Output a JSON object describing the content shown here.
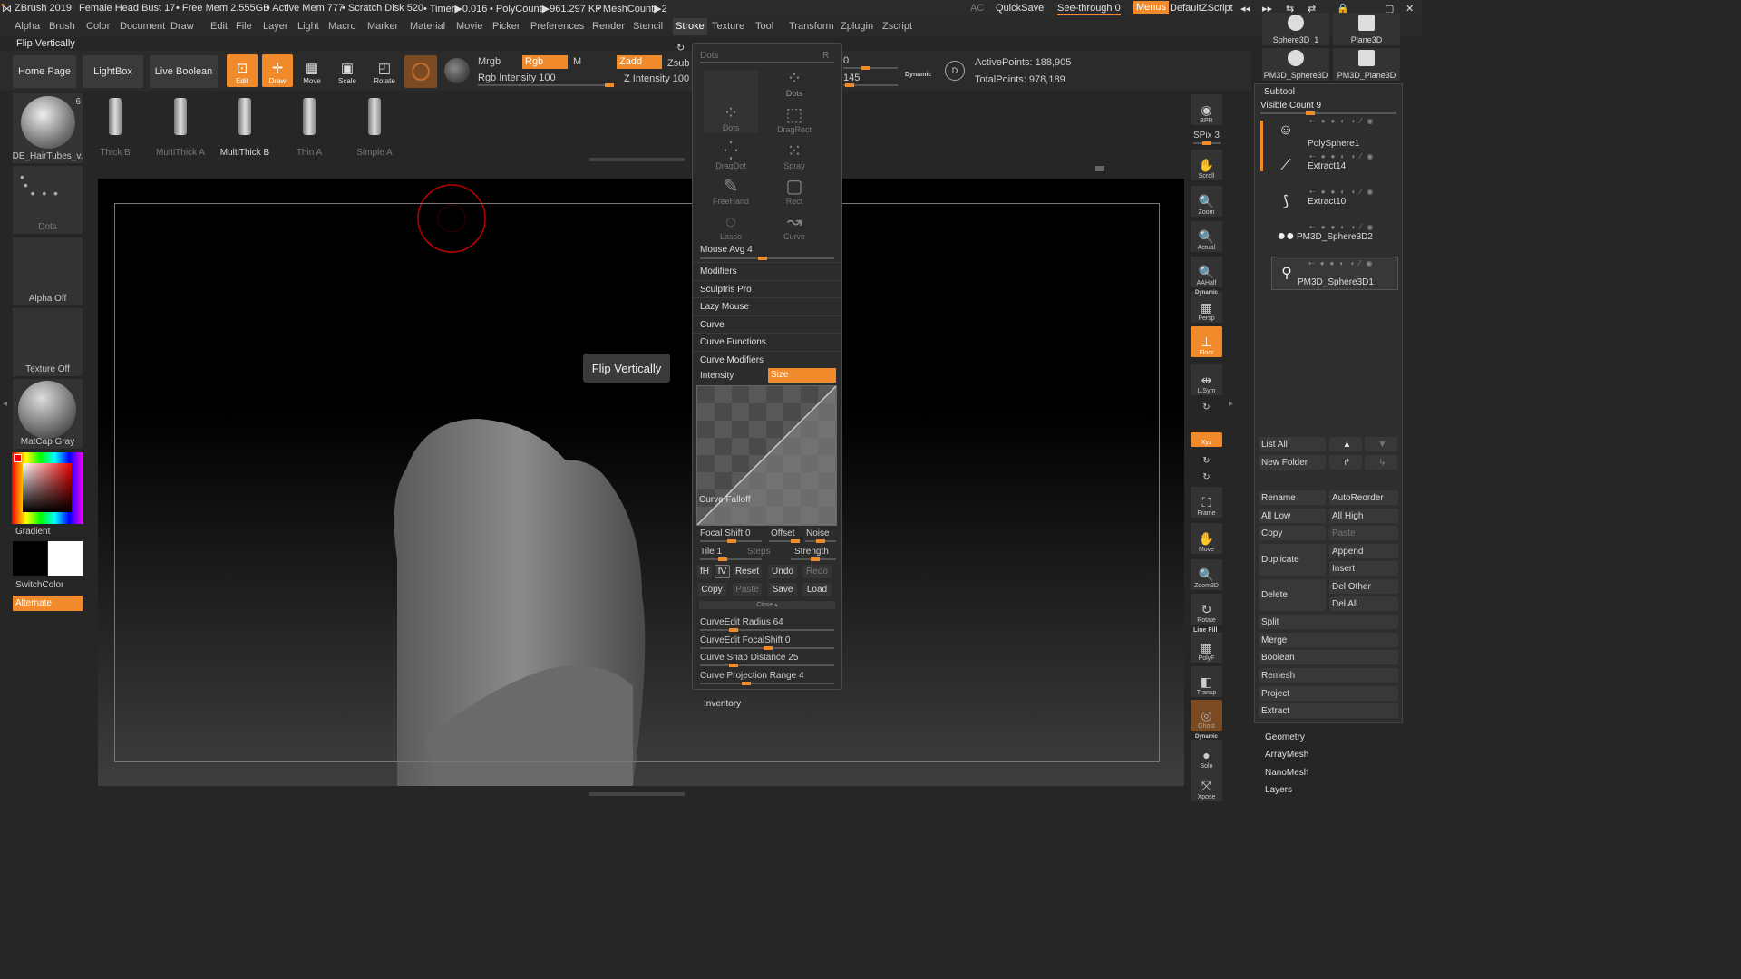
{
  "titlebar": {
    "app": "ZBrush 2019",
    "document": "Female Head Bust 17",
    "free_mem": "• Free Mem 2.555GB",
    "active_mem": "• Active Mem 777",
    "scratch": "• Scratch Disk 520",
    "timer": "• Timer▶0.016",
    "polycount": "• PolyCount▶961.297 KP",
    "meshcount": "• MeshCount▶2",
    "ac": "AC",
    "quicksave": "QuickSave",
    "seethrough": "See-through  0",
    "menus": "Menus",
    "script": "DefaultZScript"
  },
  "menus": [
    "Alpha",
    "Brush",
    "Color",
    "Document",
    "Draw",
    "Edit",
    "File",
    "Layer",
    "Light",
    "Macro",
    "Marker",
    "Material",
    "Movie",
    "Picker",
    "Preferences",
    "Render",
    "Stencil",
    "Stroke",
    "Texture",
    "Tool",
    "Transform",
    "Zplugin",
    "Zscript"
  ],
  "active_menu": "Stroke",
  "flip_label": "Flip Vertically",
  "toolbar": {
    "home": "Home Page",
    "lightbox": "LightBox",
    "liveboolean": "Live Boolean",
    "edit": "Edit",
    "draw": "Draw",
    "move": "Move",
    "scale": "Scale",
    "rotate": "Rotate",
    "mrgb": "Mrgb",
    "rgb": "Rgb",
    "m": "M",
    "zadd": "Zadd",
    "zsub": "Zsub",
    "rgb_intensity": "Rgb Intensity 100",
    "z_intensity": "Z Intensity 100",
    "dynamic": "Dynamic",
    "active_points": "ActivePoints: 188,905",
    "total_points": "TotalPoints: 978,189",
    "zero": "0",
    "focal_val": "145"
  },
  "shelf": {
    "brushes": [
      "Thick B",
      "MultiThick A",
      "MultiThick B",
      "Thin A",
      "Simple A"
    ],
    "selected": "MultiThick B"
  },
  "left": {
    "brush_name": "DE_HairTubes_v.",
    "brush_count": "6",
    "stroke": "Dots",
    "alpha": "Alpha Off",
    "texture": "Texture Off",
    "material": "MatCap Gray",
    "gradient": "Gradient",
    "switchcolor": "SwitchColor",
    "alternate": "Alternate"
  },
  "tooltip": "Flip Vertically",
  "stroke_palette": {
    "header": "Dots",
    "header_r": "R",
    "icons": [
      "Dots",
      "Dots",
      "DragRect",
      "DragDot",
      "Spray",
      "FreeHand",
      "Rect",
      "Lasso",
      "Curve"
    ],
    "mouse_avg": "Mouse Avg 4",
    "sections": [
      "Modifiers",
      "Sculptris Pro",
      "Lazy Mouse",
      "Curve",
      "Curve Functions",
      "Curve Modifiers"
    ],
    "intensity": "Intensity",
    "size": "Size",
    "curve_falloff": "Curve Falloff",
    "focal_shift": "Focal Shift 0",
    "offset": "Offset",
    "noise": "Noise",
    "tile": "Tile 1",
    "steps": "Steps",
    "strength": "Strength",
    "fh": "fH",
    "fv": "fV",
    "reset": "Reset",
    "undo": "Undo",
    "redo": "Redo",
    "copy": "Copy",
    "paste": "Paste",
    "save": "Save",
    "load": "Load",
    "close": "Close ▴",
    "curve_edit_radius": "CurveEdit Radius 64",
    "curve_edit_focal": "CurveEdit FocalShift 0",
    "curve_snap": "Curve Snap Distance 25",
    "curve_projection": "Curve Projection Range 4",
    "inventory": "Inventory"
  },
  "right_tools": [
    "BPR",
    "Scroll",
    "Zoom",
    "Actual",
    "AAHalf",
    "Persp",
    "Floor",
    "L.Sym",
    "",
    "Xyz",
    "",
    "",
    "Frame",
    "Move",
    "Zoom3D",
    "Rotate",
    "PolyF",
    "Transp",
    "Ghost",
    "Solo",
    "Xpose"
  ],
  "spix": "SPix 3",
  "dynamic_lbl": "Dynamic",
  "linefill_lbl": "Line Fill",
  "subtool": {
    "title": "Subtool",
    "visible_count": "Visible Count 9",
    "items": [
      "PolySphere1",
      "Extract14",
      "Extract10",
      "PM3D_Sphere3D2",
      "PM3D_Sphere3D1"
    ],
    "top_thumbs": [
      "Sphere3D_1",
      "Plane3D",
      "PM3D_Sphere3D",
      "PM3D_Plane3D"
    ],
    "list_all": "List All",
    "new_folder": "New Folder",
    "rename": "Rename",
    "autoreorder": "AutoReorder",
    "all_low": "All Low",
    "all_high": "All High",
    "copy": "Copy",
    "paste": "Paste",
    "duplicate": "Duplicate",
    "append": "Append",
    "insert": "Insert",
    "delete": "Delete",
    "del_other": "Del Other",
    "del_all": "Del All",
    "split": "Split",
    "merge": "Merge",
    "boolean": "Boolean",
    "remesh": "Remesh",
    "project": "Project",
    "extract": "Extract",
    "geometry": "Geometry",
    "arraymesh": "ArrayMesh",
    "nanomesh": "NanoMesh",
    "layers": "Layers"
  },
  "colors": {
    "accent": "#f08a2a",
    "panel": "#2c2c2c",
    "bg": "#262626"
  }
}
